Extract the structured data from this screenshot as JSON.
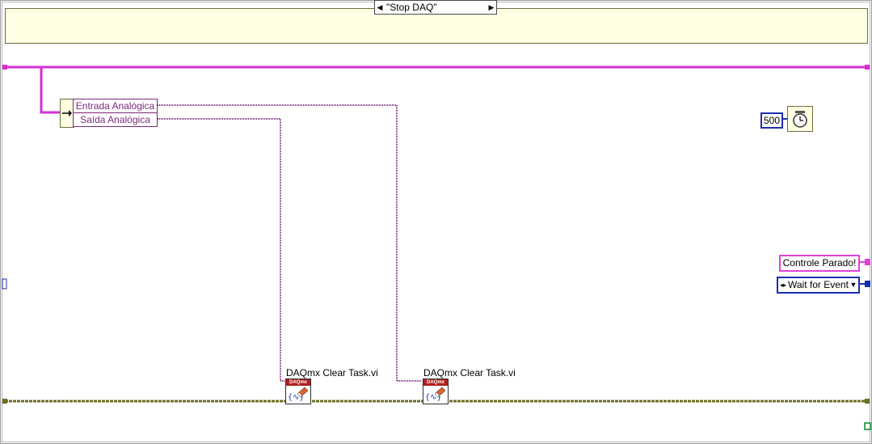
{
  "case_selector": {
    "prev_arrow": "◀",
    "label": "\"Stop DAQ\"",
    "next_arrow": "▶",
    "dropdown_arrow": "▼"
  },
  "unbundle": {
    "items": [
      "Entrada Analógica",
      "Saída Analógica"
    ]
  },
  "clear_task_1": {
    "caption": "DAQmx Clear Task.vi",
    "icon_header": "DAQmx"
  },
  "clear_task_2": {
    "caption": "DAQmx Clear Task.vi",
    "icon_header": "DAQmx"
  },
  "wait_constant": {
    "value": "500"
  },
  "string_constant": {
    "value": "Controle Parado!"
  },
  "enum_constant": {
    "value": "Wait for Event",
    "dropdown_arrow": "▼"
  },
  "colors": {
    "cluster_wire": "#d62fd6",
    "refnum_wire": "#7b2a7b",
    "error_wire": "#6e6e24",
    "numeric_blue": "#1a2fb0",
    "string_pink": "#e040e0",
    "node_fill": "#ffffe3"
  },
  "icons": {
    "wait_ms": "stopwatch-icon",
    "clear_task": "eraser-icon"
  }
}
